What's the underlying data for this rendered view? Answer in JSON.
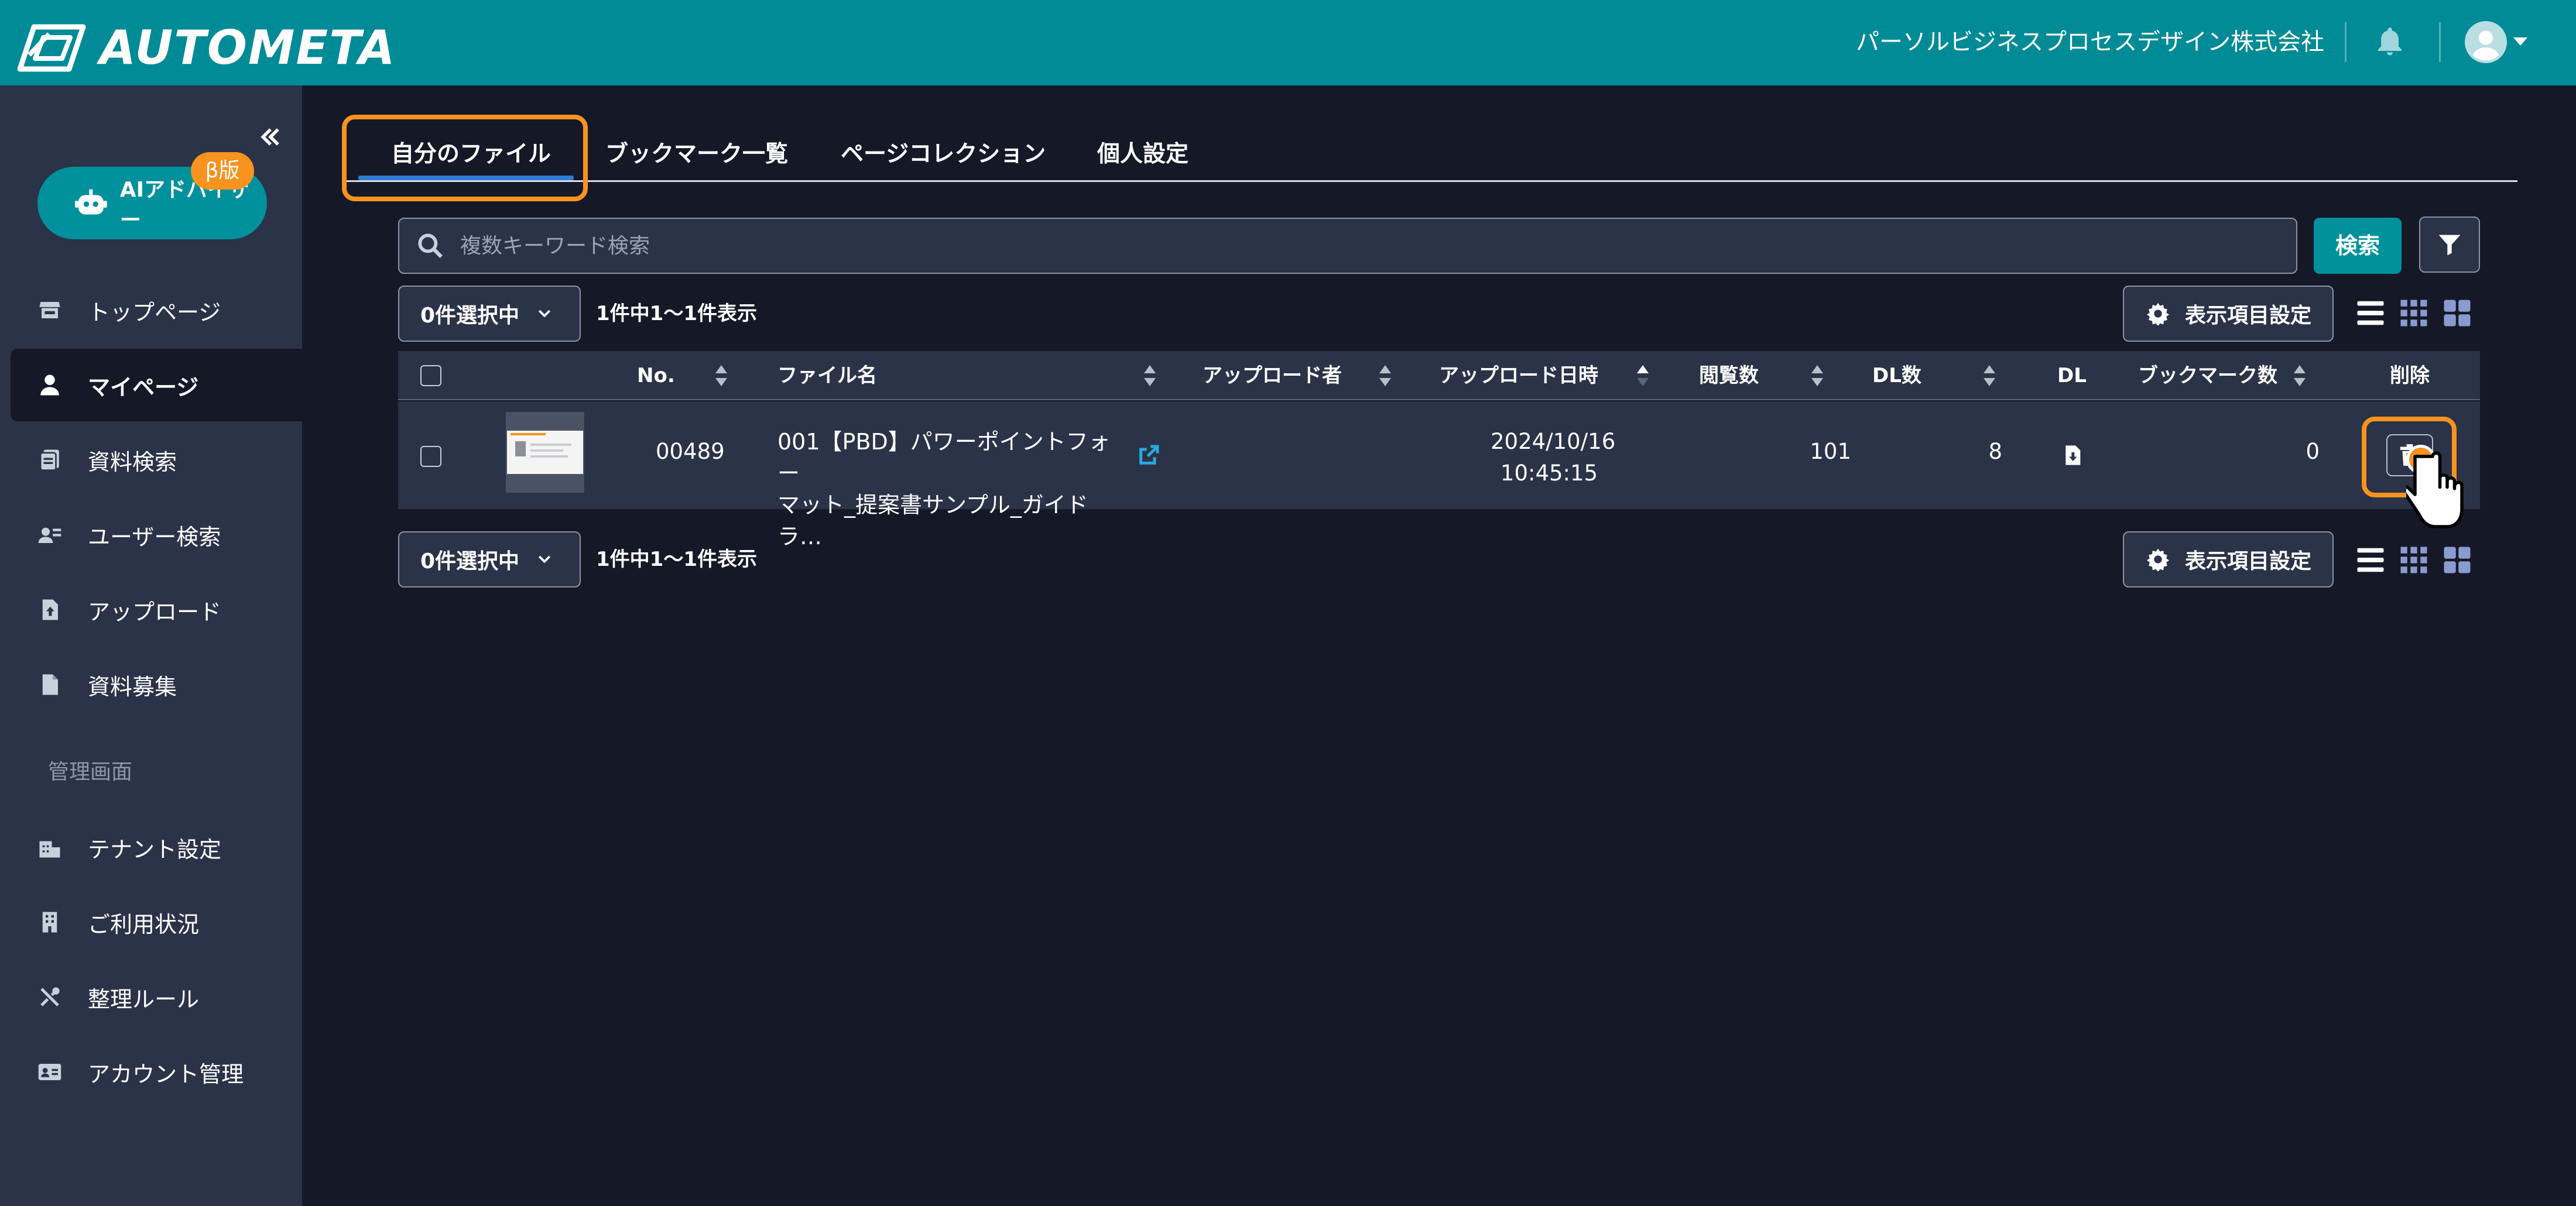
{
  "header": {
    "app_name": "AUTOMETA",
    "company": "パーソルビジネスプロセスデザイン株式会社",
    "notification_icon": "bell-icon",
    "user_icon": "user-circle-icon",
    "accent_color": "#008b96"
  },
  "sidebar": {
    "collapse_label": "«",
    "ai_advisor": {
      "label": "AIアドバイザー",
      "badge": "β版"
    },
    "items": [
      {
        "label": "トップページ",
        "icon": "store-icon"
      },
      {
        "label": "マイページ",
        "icon": "user-icon",
        "active": true
      },
      {
        "label": "資料検索",
        "icon": "documents-icon"
      },
      {
        "label": "ユーザー検索",
        "icon": "user-search-icon"
      },
      {
        "label": "アップロード",
        "icon": "file-upload-icon"
      },
      {
        "label": "資料募集",
        "icon": "file-icon"
      }
    ],
    "admin_section_label": "管理画面",
    "admin_items": [
      {
        "label": "テナント設定",
        "icon": "building-settings-icon"
      },
      {
        "label": "ご利用状況",
        "icon": "building-icon"
      },
      {
        "label": "整理ルール",
        "icon": "tools-icon"
      },
      {
        "label": "アカウント管理",
        "icon": "id-card-icon"
      }
    ]
  },
  "tabs": [
    {
      "label": "自分のファイル",
      "active": true
    },
    {
      "label": "ブックマーク一覧"
    },
    {
      "label": "ページコレクション"
    },
    {
      "label": "個人設定"
    }
  ],
  "search": {
    "placeholder": "複数キーワード検索",
    "value": "",
    "button_label": "検索"
  },
  "toolbar": {
    "selection_label": "0件選択中",
    "count_text": "1件中1～1件表示",
    "column_settings_label": "表示項目設定"
  },
  "table": {
    "columns": [
      "No.",
      "ファイル名",
      "アップロード者",
      "アップロード日時",
      "閲覧数",
      "DL数",
      "DL",
      "ブックマーク数",
      "削除"
    ],
    "rows": [
      {
        "no": "00489",
        "file_name": "001【PBD】パワーポイントフォーマット_提案書サンプル_ガイドラ…",
        "file_name_line1": "001【PBD】パワーポイントフォー",
        "file_name_line2": "マット_提案書サンプル_ガイドラ…",
        "uploader": "",
        "upload_date": "2024/10/16",
        "upload_time": "10:45:15",
        "views": "101",
        "downloads": "8",
        "bookmarks": "0"
      }
    ]
  },
  "highlight_color": "#f7931e"
}
